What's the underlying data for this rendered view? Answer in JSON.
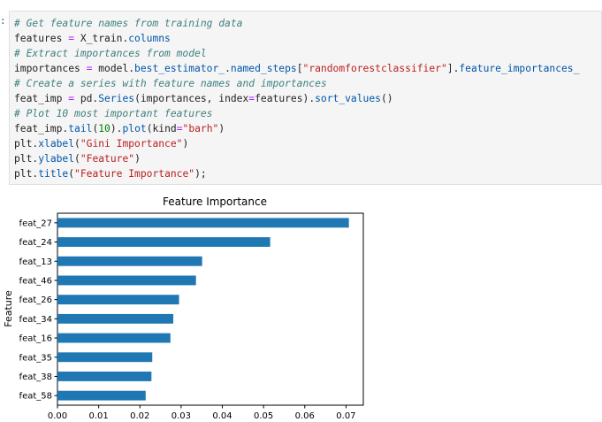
{
  "notebook": {
    "prompt_mark": ":",
    "code_cell": {
      "lines": [
        {
          "tokens": [
            {
              "t": "cm",
              "v": "# Get feature names from training data"
            }
          ]
        },
        {
          "tokens": [
            {
              "t": "",
              "v": "features "
            },
            {
              "t": "op",
              "v": "="
            },
            {
              "t": "",
              "v": " X_train."
            },
            {
              "t": "fn",
              "v": "columns"
            }
          ]
        },
        {
          "tokens": [
            {
              "t": "cm",
              "v": "# Extract importances from model"
            }
          ]
        },
        {
          "tokens": [
            {
              "t": "",
              "v": "importances "
            },
            {
              "t": "op",
              "v": "="
            },
            {
              "t": "",
              "v": " model."
            },
            {
              "t": "fn",
              "v": "best_estimator_"
            },
            {
              "t": "",
              "v": "."
            },
            {
              "t": "fn",
              "v": "named_steps"
            },
            {
              "t": "",
              "v": "["
            },
            {
              "t": "st",
              "v": "\"randomforestclassifier\""
            },
            {
              "t": "",
              "v": "]."
            },
            {
              "t": "fn",
              "v": "feature_importances_"
            }
          ]
        },
        {
          "tokens": [
            {
              "t": "cm",
              "v": "# Create a series with feature names and importances"
            }
          ]
        },
        {
          "tokens": [
            {
              "t": "",
              "v": "feat_imp "
            },
            {
              "t": "op",
              "v": "="
            },
            {
              "t": "",
              "v": " pd."
            },
            {
              "t": "fn",
              "v": "Series"
            },
            {
              "t": "",
              "v": "(importances, index"
            },
            {
              "t": "op",
              "v": "="
            },
            {
              "t": "",
              "v": "features)."
            },
            {
              "t": "fn",
              "v": "sort_values"
            },
            {
              "t": "",
              "v": "()"
            }
          ]
        },
        {
          "tokens": [
            {
              "t": "cm",
              "v": "# Plot 10 most important features"
            }
          ]
        },
        {
          "tokens": [
            {
              "t": "",
              "v": "feat_imp."
            },
            {
              "t": "fn",
              "v": "tail"
            },
            {
              "t": "",
              "v": "("
            },
            {
              "t": "nm",
              "v": "10"
            },
            {
              "t": "",
              "v": ")."
            },
            {
              "t": "fn",
              "v": "plot"
            },
            {
              "t": "",
              "v": "(kind"
            },
            {
              "t": "op",
              "v": "="
            },
            {
              "t": "st",
              "v": "\"barh\""
            },
            {
              "t": "",
              "v": ")"
            }
          ]
        },
        {
          "tokens": [
            {
              "t": "",
              "v": "plt."
            },
            {
              "t": "fn",
              "v": "xlabel"
            },
            {
              "t": "",
              "v": "("
            },
            {
              "t": "st",
              "v": "\"Gini Importance\""
            },
            {
              "t": "",
              "v": ")"
            }
          ]
        },
        {
          "tokens": [
            {
              "t": "",
              "v": "plt."
            },
            {
              "t": "fn",
              "v": "ylabel"
            },
            {
              "t": "",
              "v": "("
            },
            {
              "t": "st",
              "v": "\"Feature\""
            },
            {
              "t": "",
              "v": ")"
            }
          ]
        },
        {
          "tokens": [
            {
              "t": "",
              "v": "plt."
            },
            {
              "t": "fn",
              "v": "title"
            },
            {
              "t": "",
              "v": "("
            },
            {
              "t": "st",
              "v": "\"Feature Importance\""
            },
            {
              "t": "",
              "v": ");"
            }
          ]
        }
      ]
    },
    "colors": {
      "bar": "#1f77b4"
    }
  },
  "chart_data": {
    "type": "bar",
    "orientation": "horizontal",
    "title": "Feature Importance",
    "xlabel": "",
    "ylabel": "Feature",
    "categories": [
      "feat_27",
      "feat_24",
      "feat_13",
      "feat_46",
      "feat_26",
      "feat_34",
      "feat_16",
      "feat_35",
      "feat_38",
      "feat_58"
    ],
    "values": [
      0.0707,
      0.0516,
      0.0351,
      0.0336,
      0.0295,
      0.0281,
      0.0274,
      0.023,
      0.0228,
      0.0214
    ],
    "xlim": [
      0,
      0.0742
    ],
    "xticks": [
      0.0,
      0.01,
      0.02,
      0.03,
      0.04,
      0.05,
      0.06,
      0.07
    ],
    "xtick_labels": [
      "0.00",
      "0.01",
      "0.02",
      "0.03",
      "0.04",
      "0.05",
      "0.06",
      "0.07"
    ],
    "grid": false,
    "legend": "none"
  }
}
